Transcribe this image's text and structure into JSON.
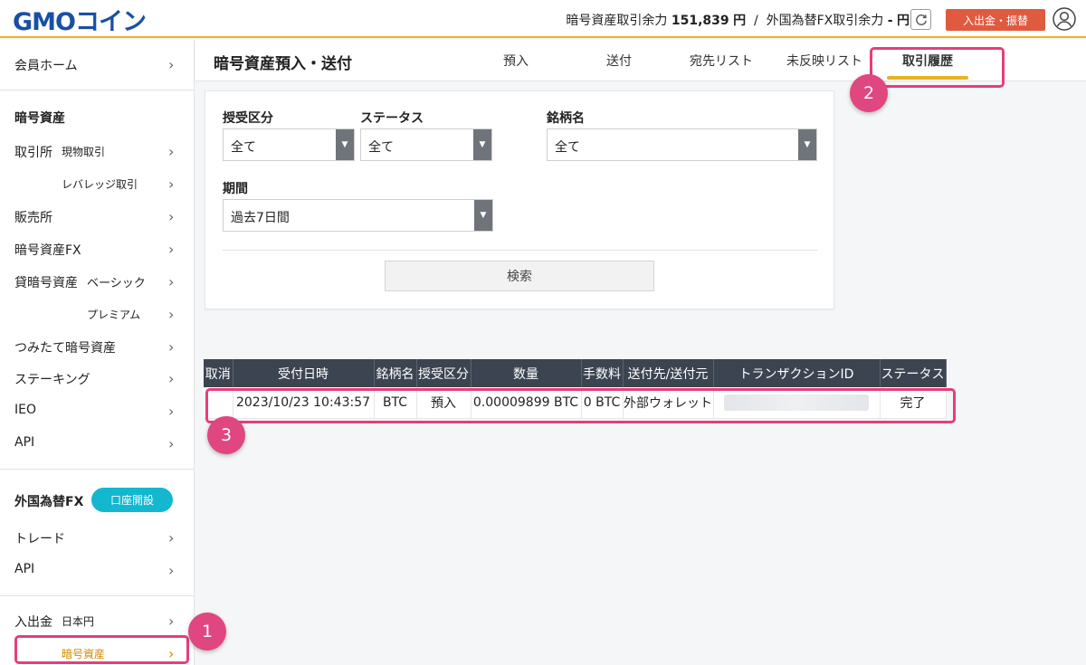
{
  "header": {
    "logo_text": "GMOコイン",
    "balance_label_1": "暗号資産取引余力",
    "balance_value_1": "151,839",
    "balance_unit_1": "円",
    "separator": "/",
    "balance_label_2": "外国為替FX取引余力",
    "balance_value_2": "-",
    "balance_unit_2": "円",
    "deposit_button": "入出金・振替",
    "accent_color": "#e6b422",
    "deposit_color": "#e05a3f"
  },
  "sidebar": {
    "home": "会員ホーム",
    "crypto_section": "暗号資産",
    "exchange": "取引所",
    "exchange_spot": "現物取引",
    "exchange_leverage": "レバレッジ取引",
    "sales": "販売所",
    "crypto_fx": "暗号資産FX",
    "lending": "貸暗号資産",
    "lending_basic": "ベーシック",
    "lending_premium": "プレミアム",
    "tsumitate": "つみたて暗号資産",
    "staking": "ステーキング",
    "ieo": "IEO",
    "api": "API",
    "fx_section": "外国為替FX",
    "open_account": "口座開設",
    "trade": "トレード",
    "fx_api": "API",
    "deposit": "入出金",
    "deposit_jpy": "日本円",
    "deposit_crypto": "暗号資産"
  },
  "main": {
    "title": "暗号資産預入・送付",
    "tabs": [
      "預入",
      "送付",
      "宛先リスト",
      "未反映リスト",
      "取引履歴"
    ]
  },
  "filter": {
    "type_label": "授受区分",
    "type_value": "全て",
    "status_label": "ステータス",
    "status_value": "全て",
    "symbol_label": "銘柄名",
    "symbol_value": "全て",
    "period_label": "期間",
    "period_value": "過去7日間",
    "search_button": "検索"
  },
  "table": {
    "headers": [
      "取消",
      "受付日時",
      "銘柄名",
      "授受区分",
      "数量",
      "手数料",
      "送付先/送付元",
      "トランザクションID",
      "ステータス"
    ],
    "rows": [
      [
        "",
        "2023/10/23 10:43:57",
        "BTC",
        "預入",
        "0.00009899 BTC",
        "0 BTC",
        "外部ウォレット",
        "",
        "完了"
      ]
    ]
  },
  "annotations": [
    "1",
    "2",
    "3"
  ]
}
